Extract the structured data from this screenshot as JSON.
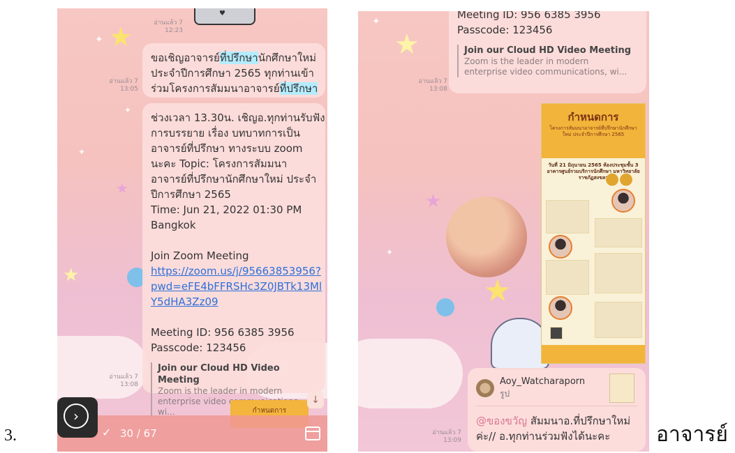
{
  "page": {
    "list_number": "3.",
    "trailing_word": "อาจารย์"
  },
  "left_phone": {
    "read_receipts": [
      {
        "label": "อ่านแล้ว 7",
        "time": "12:23"
      },
      {
        "label": "อ่านแล้ว 7",
        "time": "13:05"
      },
      {
        "label": "อ่านแล้ว 7",
        "time": "13:08"
      }
    ],
    "message1": {
      "line1_a": "ขอเชิญอาจารย์",
      "line1_hl": "ที่ปรึกษา",
      "line1_b": "นักศึกษาใหม่",
      "line2": "ประจำปีการศึกษา 2565 ทุกท่านเข้า",
      "line3_a": "ร่วมโครงการสัมมนาอาจารย์",
      "line3_hl": "ที่ปรึกษา"
    },
    "message2": {
      "lines": [
        "ช่วงเวลา 13.30น. เชิญอ.ทุกท่านรับฟัง",
        "การบรรยาย เรื่อง บทบาทการเป็น",
        "อาจารย์ที่ปรึกษา ทางระบบ zoom",
        "นะคะ Topic: โครงการสัมมนา",
        "อาจารย์ที่ปรึกษานักศึกษาใหม่ ประจำ",
        "ปีการศึกษา 2565",
        "Time: Jun 21, 2022 01:30 PM",
        "Bangkok"
      ],
      "join_label": "Join Zoom Meeting",
      "link_lines": [
        "https://zoom.us/j/95663853956?",
        "pwd=eFE4bFFRSHc3Z0JBTk13Ml",
        "Y5dHA3Zz09"
      ],
      "meeting_id": "Meeting ID: 956 6385 3956",
      "passcode": "Passcode: 123456",
      "preview_title": "Join our Cloud HD Video Meeting",
      "preview_desc_1": "Zoom is the leader in modern",
      "preview_desc_2": "enterprise video communications, wi..."
    },
    "poster_strip_label": "กำหนดการ",
    "counter": "30 / 67",
    "next_glyph": "›",
    "down_glyph": "↓",
    "check_glyph": "✓"
  },
  "right_phone": {
    "meeting_id": "Meeting ID: 956 6385 3956",
    "passcode": "Passcode: 123456",
    "preview_title": "Join our Cloud HD Video Meeting",
    "preview_desc_1": "Zoom is the leader in modern",
    "preview_desc_2": "enterprise video communications, wi...",
    "read_receipts": [
      {
        "label": "อ่านแล้ว 7",
        "time": "13:08"
      },
      {
        "label": "อ่านแล้ว 7",
        "time": "13:09"
      }
    ],
    "poster": {
      "title": "กำหนดการ",
      "subtitle": "โครงการสัมมนาอาจารย์ที่ปรึกษานักศึกษาใหม่ ประจำปีการศึกษา 2565",
      "date": "วันที่ 21 มิถุนายน 2565 ห้องประชุมชั้น 3 อาคารศูนย์รวมบริการนักศึกษา มหาวิทยาลัยราชภัฏสงขลา"
    },
    "mention": {
      "name": "Aoy_Watcharaporn",
      "sub": "รูป",
      "at": "@ของขวัญ",
      "line1_rest": " สัมมนาอ.ที่ปรึกษาใหม่",
      "line2": "ค่ะ// อ.ทุกท่านร่วมฟังได้นะคะ"
    }
  }
}
